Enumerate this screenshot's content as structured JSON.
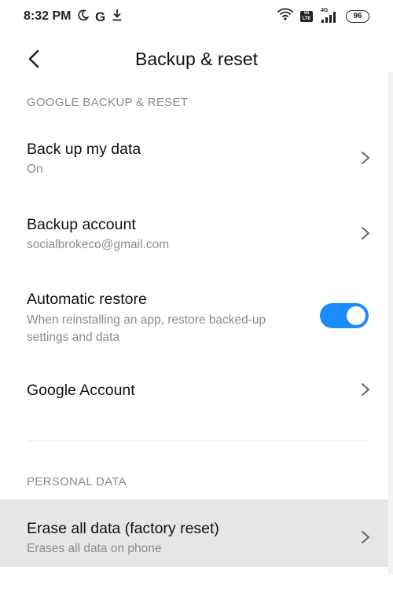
{
  "status_bar": {
    "time": "8:32 PM",
    "g_glyph": "G",
    "network_label": "4G",
    "volte_label": "Vo LTE",
    "battery": "96"
  },
  "header": {
    "title": "Backup & reset",
    "back_icon": "back-arrow-icon"
  },
  "sections": {
    "google": "GOOGLE BACKUP & RESET",
    "personal": "PERSONAL DATA"
  },
  "rows": {
    "backup_data": {
      "title": "Back up my data",
      "subtitle": "On"
    },
    "backup_account": {
      "title": "Backup account",
      "subtitle": "socialbrokeco@gmail.com"
    },
    "auto_restore": {
      "title": "Automatic restore",
      "subtitle": "When reinstalling an app, restore backed-up settings and data",
      "toggle_on": true
    },
    "google_account": {
      "title": "Google Account"
    },
    "erase_all": {
      "title": "Erase all data (factory reset)",
      "subtitle": "Erases all data on phone"
    }
  },
  "colors": {
    "accent": "#1a8cff",
    "highlight_row": "#e6e6e6",
    "section_text": "#8a8a8a"
  }
}
